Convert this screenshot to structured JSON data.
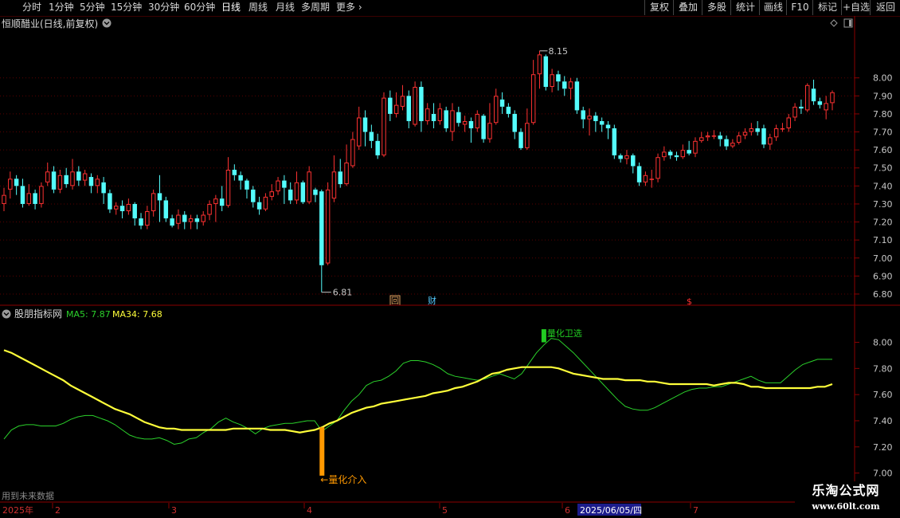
{
  "toolbar": {
    "periods": [
      "分时",
      "1分钟",
      "5分钟",
      "15分钟",
      "30分钟",
      "60分钟",
      "日线",
      "周线",
      "月线",
      "多周期",
      "更多"
    ],
    "active": "日线",
    "right_buttons": [
      "复权",
      "叠加",
      "多股",
      "统计",
      "画线",
      "F10",
      "标记",
      "+自选",
      "返回"
    ]
  },
  "main": {
    "title": "恒顺醋业(日线,前复权)",
    "high_label": "8.15",
    "low_label": "6.81",
    "markers": [
      "回",
      "财",
      "$"
    ]
  },
  "indicator": {
    "name": "股朋指标网",
    "ma5_label": "MA5: 7.87",
    "ma34_label": "MA34: 7.68",
    "buy_label": "←量化介入",
    "sell_label": "量化卫选",
    "future_note": "用到未来数据"
  },
  "footer": {
    "year_label": "2025年",
    "months": [
      "2",
      "3",
      "4",
      "5",
      "6",
      "7"
    ],
    "cursor_date": "2025/06/05/四"
  },
  "logo": {
    "name": "乐淘公式网",
    "url": "www.60lt.com"
  },
  "colors": {
    "up": "#ff3232",
    "down": "#54fcfc",
    "ma5": "#2bd12b",
    "ma34": "#ffff3a",
    "buy_bar": "#ff9900",
    "sell_bar": "#22cc22",
    "axis": "#8b0000"
  },
  "chart_data": [
    {
      "type": "candlestick",
      "title": "恒顺醋业(日线,前复权)",
      "ylim": [
        6.76,
        8.22
      ],
      "yticks": [
        6.8,
        6.9,
        7.0,
        7.1,
        7.2,
        7.3,
        7.4,
        7.5,
        7.6,
        7.7,
        7.8,
        7.9,
        8.0
      ],
      "candles": [
        [
          7.3,
          7.35,
          7.39,
          7.26
        ],
        [
          7.38,
          7.44,
          7.48,
          7.33
        ],
        [
          7.44,
          7.4,
          7.46,
          7.35
        ],
        [
          7.4,
          7.3,
          7.44,
          7.28
        ],
        [
          7.3,
          7.36,
          7.41,
          7.29
        ],
        [
          7.36,
          7.3,
          7.38,
          7.27
        ],
        [
          7.3,
          7.4,
          7.42,
          7.28
        ],
        [
          7.42,
          7.48,
          7.53,
          7.4
        ],
        [
          7.48,
          7.38,
          7.51,
          7.36
        ],
        [
          7.38,
          7.46,
          7.49,
          7.36
        ],
        [
          7.46,
          7.41,
          7.5,
          7.39
        ],
        [
          7.4,
          7.48,
          7.55,
          7.38
        ],
        [
          7.48,
          7.43,
          7.51,
          7.4
        ],
        [
          7.43,
          7.47,
          7.49,
          7.4
        ],
        [
          7.45,
          7.4,
          7.47,
          7.36
        ],
        [
          7.4,
          7.44,
          7.46,
          7.36
        ],
        [
          7.42,
          7.36,
          7.45,
          7.3
        ],
        [
          7.36,
          7.27,
          7.38,
          7.25
        ],
        [
          7.27,
          7.29,
          7.31,
          7.24
        ],
        [
          7.29,
          7.26,
          7.32,
          7.22
        ],
        [
          7.26,
          7.3,
          7.33,
          7.24
        ],
        [
          7.3,
          7.22,
          7.31,
          7.18
        ],
        [
          7.22,
          7.18,
          7.25,
          7.16
        ],
        [
          7.18,
          7.26,
          7.29,
          7.16
        ],
        [
          7.26,
          7.36,
          7.38,
          7.23
        ],
        [
          7.36,
          7.32,
          7.46,
          7.2
        ],
        [
          7.32,
          7.22,
          7.34,
          7.2
        ],
        [
          7.22,
          7.18,
          7.24,
          7.17
        ],
        [
          7.19,
          7.24,
          7.27,
          7.16
        ],
        [
          7.24,
          7.2,
          7.26,
          7.16
        ],
        [
          7.2,
          7.22,
          7.24,
          7.16
        ],
        [
          7.22,
          7.2,
          7.24,
          7.16
        ],
        [
          7.2,
          7.24,
          7.26,
          7.18
        ],
        [
          7.24,
          7.3,
          7.32,
          7.21
        ],
        [
          7.3,
          7.33,
          7.35,
          7.2
        ],
        [
          7.33,
          7.29,
          7.4,
          7.26
        ],
        [
          7.29,
          7.49,
          7.56,
          7.28
        ],
        [
          7.49,
          7.46,
          7.52,
          7.43
        ],
        [
          7.46,
          7.43,
          7.48,
          7.38
        ],
        [
          7.43,
          7.38,
          7.44,
          7.33
        ],
        [
          7.38,
          7.31,
          7.4,
          7.28
        ],
        [
          7.31,
          7.27,
          7.34,
          7.24
        ],
        [
          7.27,
          7.34,
          7.36,
          7.26
        ],
        [
          7.34,
          7.37,
          7.41,
          7.32
        ],
        [
          7.37,
          7.43,
          7.45,
          7.35
        ],
        [
          7.43,
          7.39,
          7.46,
          7.3
        ],
        [
          7.38,
          7.32,
          7.42,
          7.3
        ],
        [
          7.32,
          7.42,
          7.48,
          7.3
        ],
        [
          7.42,
          7.31,
          7.43,
          7.3
        ],
        [
          7.31,
          7.48,
          7.51,
          7.3
        ],
        [
          7.38,
          7.35,
          7.39,
          7.31
        ],
        [
          7.37,
          6.96,
          7.38,
          6.81
        ],
        [
          6.97,
          7.38,
          7.42,
          6.96
        ],
        [
          7.33,
          7.48,
          7.57,
          7.31
        ],
        [
          7.48,
          7.41,
          7.55,
          7.39
        ],
        [
          7.41,
          7.53,
          7.63,
          7.4
        ],
        [
          7.51,
          7.66,
          7.7,
          7.5
        ],
        [
          7.62,
          7.78,
          7.84,
          7.6
        ],
        [
          7.78,
          7.7,
          7.82,
          7.62
        ],
        [
          7.7,
          7.65,
          7.74,
          7.61
        ],
        [
          7.65,
          7.57,
          7.69,
          7.55
        ],
        [
          7.57,
          7.89,
          7.92,
          7.56
        ],
        [
          7.89,
          7.8,
          7.93,
          7.76
        ],
        [
          7.8,
          7.85,
          7.92,
          7.78
        ],
        [
          7.84,
          7.9,
          7.96,
          7.82
        ],
        [
          7.9,
          7.76,
          7.93,
          7.72
        ],
        [
          7.74,
          7.95,
          7.98,
          7.73
        ],
        [
          7.95,
          7.76,
          7.98,
          7.7
        ],
        [
          7.76,
          7.83,
          7.86,
          7.74
        ],
        [
          7.8,
          7.76,
          7.86,
          7.72
        ],
        [
          7.76,
          7.83,
          7.86,
          7.74
        ],
        [
          7.82,
          7.72,
          7.84,
          7.7
        ],
        [
          7.7,
          7.82,
          7.86,
          7.65
        ],
        [
          7.81,
          7.75,
          7.84,
          7.73
        ],
        [
          7.74,
          7.76,
          7.79,
          7.7
        ],
        [
          7.76,
          7.72,
          7.78,
          7.64
        ],
        [
          7.72,
          7.8,
          7.82,
          7.7
        ],
        [
          7.79,
          7.66,
          7.8,
          7.64
        ],
        [
          7.66,
          7.75,
          7.86,
          7.64
        ],
        [
          7.75,
          7.9,
          7.94,
          7.74
        ],
        [
          7.88,
          7.84,
          7.92,
          7.8
        ],
        [
          7.84,
          7.8,
          7.86,
          7.78
        ],
        [
          7.8,
          7.7,
          7.82,
          7.66
        ],
        [
          7.7,
          7.61,
          7.72,
          7.6
        ],
        [
          7.61,
          7.75,
          7.83,
          7.6
        ],
        [
          7.75,
          8.02,
          8.1,
          7.74
        ],
        [
          8.02,
          8.13,
          8.15,
          7.94
        ],
        [
          8.12,
          7.95,
          8.13,
          7.93
        ],
        [
          7.95,
          8.02,
          8.05,
          7.92
        ],
        [
          8.02,
          7.98,
          8.04,
          7.93
        ],
        [
          7.98,
          7.94,
          8.01,
          7.9
        ],
        [
          7.94,
          7.98,
          8.0,
          7.88
        ],
        [
          7.98,
          7.82,
          8.0,
          7.8
        ],
        [
          7.82,
          7.77,
          7.84,
          7.72
        ],
        [
          7.77,
          7.79,
          7.83,
          7.68
        ],
        [
          7.79,
          7.76,
          7.81,
          7.7
        ],
        [
          7.76,
          7.74,
          7.78,
          7.7
        ],
        [
          7.74,
          7.72,
          7.76,
          7.66
        ],
        [
          7.72,
          7.57,
          7.74,
          7.55
        ],
        [
          7.57,
          7.55,
          7.58,
          7.53
        ],
        [
          7.55,
          7.57,
          7.6,
          7.52
        ],
        [
          7.57,
          7.51,
          7.58,
          7.47
        ],
        [
          7.51,
          7.42,
          7.53,
          7.4
        ],
        [
          7.42,
          7.46,
          7.48,
          7.4
        ],
        [
          7.44,
          7.44,
          7.49,
          7.39
        ],
        [
          7.44,
          7.56,
          7.58,
          7.42
        ],
        [
          7.56,
          7.59,
          7.62,
          7.54
        ],
        [
          7.59,
          7.57,
          7.6,
          7.55
        ],
        [
          7.57,
          7.56,
          7.59,
          7.54
        ],
        [
          7.56,
          7.6,
          7.63,
          7.55
        ],
        [
          7.6,
          7.58,
          7.65,
          7.57
        ],
        [
          7.58,
          7.65,
          7.67,
          7.56
        ],
        [
          7.65,
          7.67,
          7.7,
          7.64
        ],
        [
          7.67,
          7.68,
          7.7,
          7.65
        ],
        [
          7.68,
          7.68,
          7.71,
          7.66
        ],
        [
          7.68,
          7.66,
          7.7,
          7.62
        ],
        [
          7.66,
          7.62,
          7.68,
          7.6
        ],
        [
          7.62,
          7.64,
          7.66,
          7.61
        ],
        [
          7.64,
          7.68,
          7.7,
          7.63
        ],
        [
          7.68,
          7.7,
          7.72,
          7.66
        ],
        [
          7.7,
          7.72,
          7.75,
          7.68
        ],
        [
          7.72,
          7.7,
          7.76,
          7.68
        ],
        [
          7.72,
          7.63,
          7.74,
          7.61
        ],
        [
          7.63,
          7.67,
          7.69,
          7.6
        ],
        [
          7.67,
          7.72,
          7.74,
          7.65
        ],
        [
          7.72,
          7.72,
          7.75,
          7.7
        ],
        [
          7.72,
          7.78,
          7.8,
          7.7
        ],
        [
          7.78,
          7.84,
          7.86,
          7.76
        ],
        [
          7.84,
          7.83,
          7.88,
          7.8
        ],
        [
          7.82,
          7.96,
          7.97,
          7.81
        ],
        [
          7.94,
          7.87,
          7.99,
          7.85
        ],
        [
          7.87,
          7.85,
          7.89,
          7.83
        ],
        [
          7.82,
          7.86,
          7.9,
          7.77
        ],
        [
          7.86,
          7.92,
          7.93,
          7.82
        ]
      ]
    },
    {
      "type": "line",
      "title": "股朋指标网",
      "ylim": [
        6.9,
        8.18
      ],
      "yticks": [
        7.0,
        7.2,
        7.4,
        7.6,
        7.8,
        8.0
      ],
      "series": [
        {
          "name": "MA5",
          "color": "#2bd12b",
          "values": [
            7.26,
            7.33,
            7.36,
            7.37,
            7.37,
            7.36,
            7.36,
            7.36,
            7.38,
            7.41,
            7.43,
            7.44,
            7.44,
            7.42,
            7.4,
            7.37,
            7.33,
            7.29,
            7.27,
            7.26,
            7.26,
            7.27,
            7.25,
            7.22,
            7.23,
            7.26,
            7.27,
            7.31,
            7.34,
            7.39,
            7.42,
            7.39,
            7.37,
            7.34,
            7.3,
            7.34,
            7.36,
            7.37,
            7.38,
            7.38,
            7.39,
            7.4,
            7.4,
            7.32,
            7.36,
            7.4,
            7.48,
            7.55,
            7.6,
            7.67,
            7.7,
            7.71,
            7.74,
            7.78,
            7.84,
            7.86,
            7.86,
            7.85,
            7.83,
            7.8,
            7.76,
            7.74,
            7.73,
            7.72,
            7.71,
            7.72,
            7.74,
            7.76,
            7.74,
            7.72,
            7.76,
            7.84,
            7.92,
            7.98,
            8.03,
            8.02,
            7.97,
            7.92,
            7.86,
            7.8,
            7.74,
            7.68,
            7.62,
            7.56,
            7.51,
            7.49,
            7.48,
            7.48,
            7.5,
            7.53,
            7.56,
            7.59,
            7.62,
            7.64,
            7.65,
            7.65,
            7.66,
            7.66,
            7.68,
            7.7,
            7.72,
            7.74,
            7.71,
            7.69,
            7.69,
            7.69,
            7.74,
            7.79,
            7.83,
            7.85,
            7.87,
            7.87,
            7.87
          ]
        },
        {
          "name": "MA34",
          "color": "#ffff3a",
          "values": [
            7.94,
            7.92,
            7.89,
            7.86,
            7.83,
            7.8,
            7.77,
            7.74,
            7.71,
            7.67,
            7.64,
            7.61,
            7.58,
            7.55,
            7.52,
            7.49,
            7.47,
            7.45,
            7.42,
            7.39,
            7.37,
            7.35,
            7.34,
            7.34,
            7.33,
            7.33,
            7.33,
            7.33,
            7.33,
            7.33,
            7.33,
            7.34,
            7.34,
            7.34,
            7.34,
            7.34,
            7.33,
            7.33,
            7.33,
            7.32,
            7.31,
            7.32,
            7.33,
            7.35,
            7.38,
            7.4,
            7.43,
            7.46,
            7.48,
            7.5,
            7.51,
            7.53,
            7.54,
            7.55,
            7.56,
            7.57,
            7.58,
            7.59,
            7.61,
            7.62,
            7.63,
            7.65,
            7.66,
            7.68,
            7.7,
            7.73,
            7.76,
            7.77,
            7.79,
            7.8,
            7.81,
            7.81,
            7.81,
            7.81,
            7.81,
            7.8,
            7.78,
            7.76,
            7.75,
            7.74,
            7.73,
            7.72,
            7.72,
            7.72,
            7.71,
            7.71,
            7.71,
            7.7,
            7.7,
            7.69,
            7.68,
            7.68,
            7.68,
            7.68,
            7.68,
            7.68,
            7.67,
            7.68,
            7.69,
            7.69,
            7.68,
            7.66,
            7.66,
            7.65,
            7.65,
            7.65,
            7.65,
            7.65,
            7.65,
            7.65,
            7.66,
            7.66,
            7.68
          ]
        }
      ],
      "signals": [
        {
          "label": "←量化介入",
          "color": "#ff9900",
          "index": 43,
          "from": 6.98,
          "to": 7.35
        },
        {
          "label": "量化卫选",
          "color": "#22cc22",
          "index": 73,
          "from": 8.0,
          "to": 8.1
        }
      ]
    }
  ]
}
